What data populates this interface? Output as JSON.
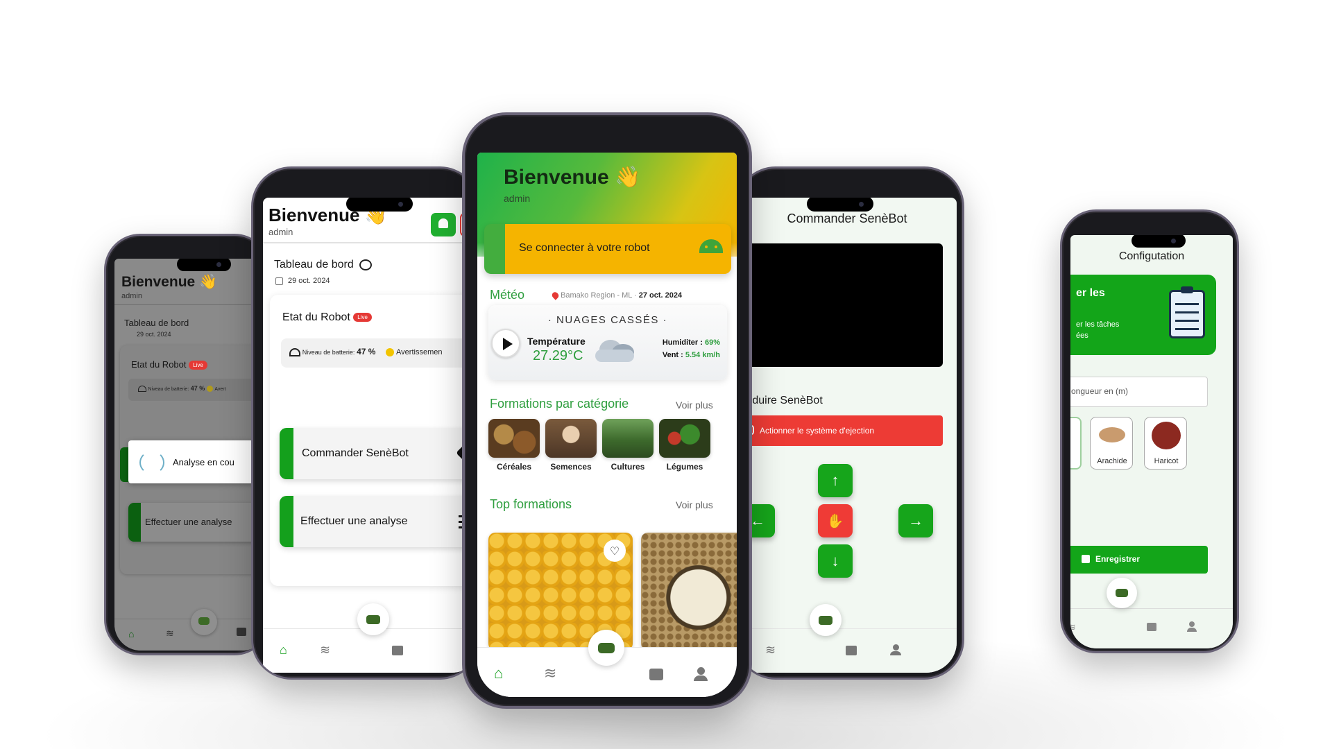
{
  "phone1": {
    "welcome": "Bienvenue 👋",
    "user": "admin",
    "dashboard_title": "Tableau de bord",
    "date": "29 oct. 2024",
    "robot_state": "Etat du Robot",
    "live": "Live",
    "battery_label": "Niveau de batterie:",
    "battery_value": "47 %",
    "warning": "Avert",
    "loading_text": "Analyse en cou",
    "analyse_button": "Effectuer une analyse"
  },
  "phone2": {
    "welcome": "Bienvenue 👋",
    "user": "admin",
    "dashboard_title": "Tableau de bord",
    "date": "29 oct. 2024",
    "robot_state": "Etat du Robot",
    "live": "Live",
    "battery_label": "Niveau de batterie:",
    "battery_value": "47 %",
    "warning": "Avertissemen",
    "command_button": "Commander SenèBot",
    "analyse_button": "Effectuer une analyse"
  },
  "phone3": {
    "welcome": "Bienvenue 👋",
    "user": "admin",
    "connect_button": "Se connecter à votre robot",
    "meteo_title": "Météo",
    "location": "Bamako Region -  ML",
    "date": "27 oct. 2024",
    "weather_desc": "· NUAGES CASSÉS ·",
    "temperature_label": "Température",
    "temperature_value": "27.29°C",
    "humidity_label": "Humiditer :",
    "humidity_value": "69%",
    "wind_label": "Vent :",
    "wind_value": "5.54 km/h",
    "formations_cat_title": "Formations par catégorie",
    "voir_plus_1": "Voir plus",
    "categories": [
      "Céréales",
      "Semences",
      "Cultures",
      "Légumes"
    ],
    "top_formations_title": "Top formations",
    "voir_plus_2": "Voir plus"
  },
  "phone4": {
    "title": "Commander SenèBot",
    "drive_title": "Conduire SenèBot",
    "eject_button": "Actionner le système d'ejection"
  },
  "phone5": {
    "title": "Configutation",
    "banner_line1": "er les",
    "banner_line2": "er les tâches",
    "banner_line3": "ées",
    "length_placeholder": "ongueur en (m)",
    "seeds": [
      "Arachide",
      "Haricot"
    ],
    "save_button": "Enregistrer"
  },
  "colors": {
    "brand_green": "#14a01c",
    "accent_yellow": "#f5b400",
    "alert_red": "#e53935"
  }
}
